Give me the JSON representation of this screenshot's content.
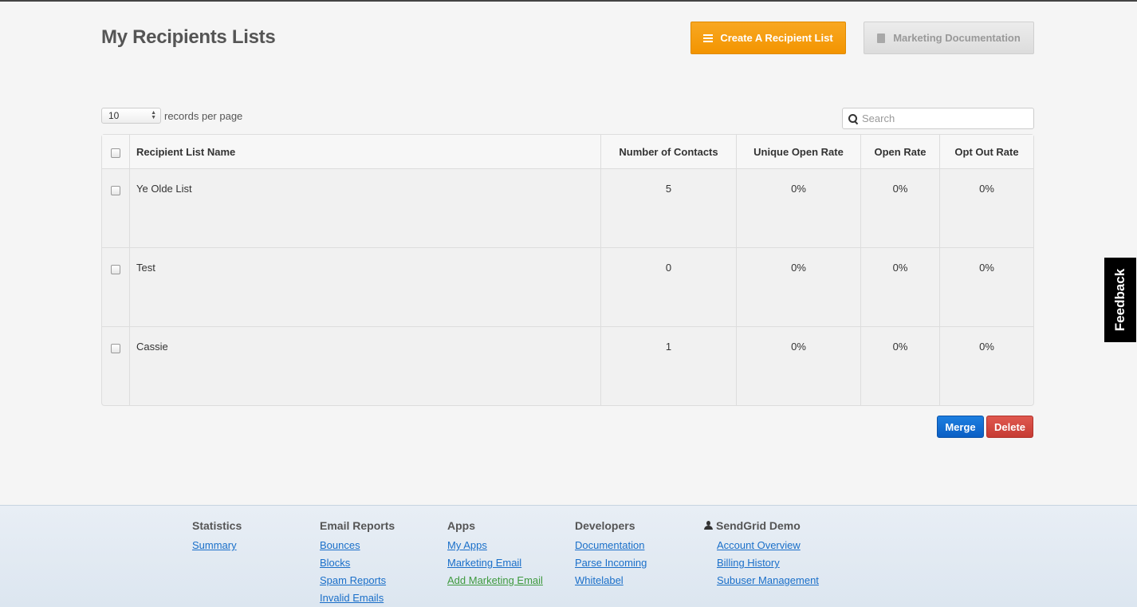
{
  "page": {
    "title": "My Recipients Lists",
    "create_button": "Create A Recipient List",
    "docs_button": "Marketing Documentation"
  },
  "controls": {
    "per_page_value": "10",
    "per_page_label": "records per page",
    "search_placeholder": "Search"
  },
  "table": {
    "columns": [
      "Recipient List Name",
      "Number of Contacts",
      "Unique Open Rate",
      "Open Rate",
      "Opt Out Rate"
    ],
    "rows": [
      {
        "name": "Ye Olde List",
        "contacts": "5",
        "unique_open_rate": "0%",
        "open_rate": "0%",
        "opt_out_rate": "0%"
      },
      {
        "name": "Test",
        "contacts": "0",
        "unique_open_rate": "0%",
        "open_rate": "0%",
        "opt_out_rate": "0%"
      },
      {
        "name": "Cassie",
        "contacts": "1",
        "unique_open_rate": "0%",
        "open_rate": "0%",
        "opt_out_rate": "0%"
      }
    ]
  },
  "actions": {
    "merge": "Merge",
    "delete": "Delete"
  },
  "feedback": "Feedback",
  "footer": {
    "statistics": {
      "title": "Statistics",
      "links": [
        "Summary"
      ]
    },
    "email_reports": {
      "title": "Email Reports",
      "links": [
        "Bounces",
        "Blocks",
        "Spam Reports",
        "Invalid Emails"
      ]
    },
    "apps": {
      "title": "Apps",
      "links": [
        "My Apps",
        "Marketing Email",
        "Add Marketing Email"
      ]
    },
    "developers": {
      "title": "Developers",
      "links": [
        "Documentation",
        "Parse Incoming",
        "Whitelabel"
      ]
    },
    "account": {
      "title": "SendGrid Demo",
      "links": [
        "Account Overview",
        "Billing History",
        "Subuser Management"
      ]
    }
  },
  "colors": {
    "create_button": "#f39400",
    "merge_button": "#0a5ec4",
    "delete_button": "#c63b33",
    "link": "#1a6fc9",
    "active_link": "#3f9a3f"
  }
}
